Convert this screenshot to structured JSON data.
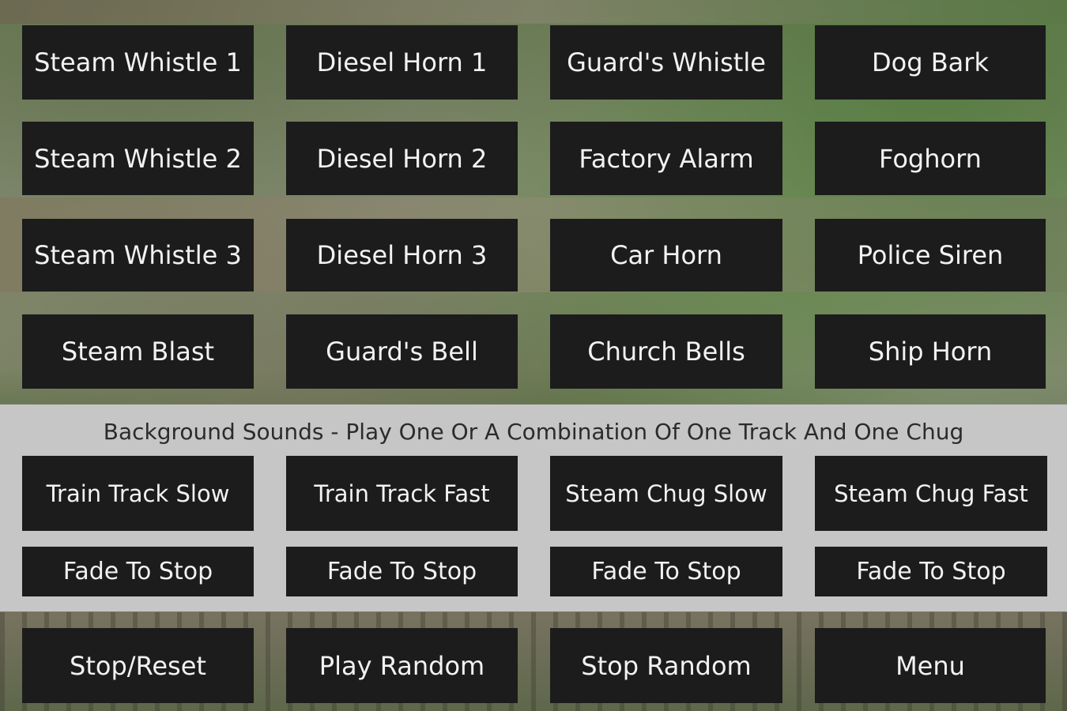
{
  "sound_buttons": [
    [
      "Steam Whistle 1",
      "Diesel Horn 1",
      "Guard's Whistle",
      "Dog Bark"
    ],
    [
      "Steam Whistle 2",
      "Diesel Horn 2",
      "Factory Alarm",
      "Foghorn"
    ],
    [
      "Steam Whistle 3",
      "Diesel Horn 3",
      "Car Horn",
      "Police Siren"
    ],
    [
      "Steam Blast",
      "Guard's Bell",
      "Church Bells",
      "Ship Horn"
    ]
  ],
  "background_panel": {
    "title": "Background Sounds - Play One Or A Combination Of One Track And One Chug",
    "tracks": [
      "Train Track Slow",
      "Train Track Fast",
      "Steam Chug Slow",
      "Steam Chug Fast"
    ],
    "fade_label": "Fade To Stop"
  },
  "footer": {
    "stop_reset": "Stop/Reset",
    "play_random": "Play Random",
    "stop_random": "Stop Random",
    "menu": "Menu"
  }
}
